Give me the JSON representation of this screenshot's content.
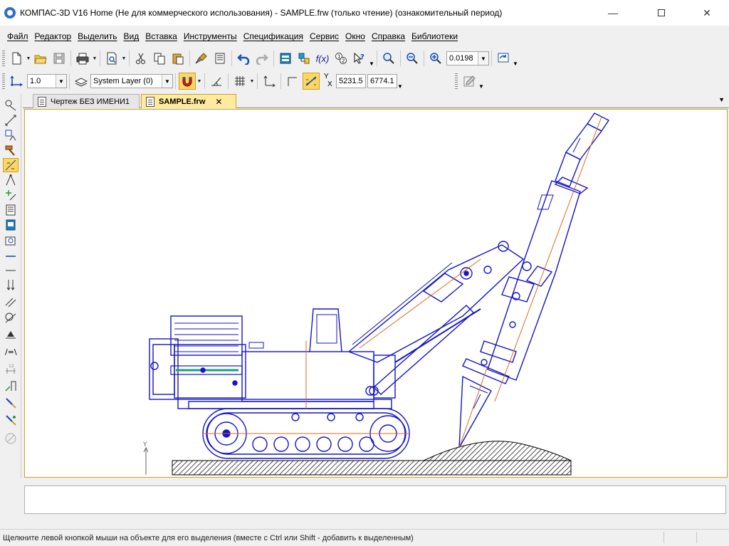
{
  "window": {
    "title": "КОМПАС-3D V16 Home  (Не для коммерческого использования) - SAMPLE.frw (только чтение) (ознакомительный период)",
    "minimize_icon": "minimize-icon",
    "maximize_icon": "maximize-icon",
    "close_icon": "close-icon"
  },
  "menu": {
    "items": [
      "Файл",
      "Редактор",
      "Выделить",
      "Вид",
      "Вставка",
      "Инструменты",
      "Спецификация",
      "Сервис",
      "Окно",
      "Справка",
      "Библиотеки"
    ]
  },
  "toolbar": {
    "zoom_value": "0.0198",
    "fx_label": "f(x)"
  },
  "properties_bar": {
    "line_scale": "1.0",
    "layer": "System Layer (0)",
    "y_label": "Y",
    "x_label": "X",
    "x_coord": "5231.5",
    "y_coord": "6774.1"
  },
  "tabs": [
    {
      "label": "Чертеж БЕЗ ИМЕНИ1",
      "active": false
    },
    {
      "label": "SAMPLE.frw",
      "active": true
    }
  ],
  "tab_close": "✕",
  "drawing": {
    "origin_y_label": "Y",
    "line_color": "#1414c8",
    "axis_color": "#e06a1a",
    "ground_color": "#000000"
  },
  "status": {
    "text": "Щелкните левой кнопкой мыши на объекте для его выделения (вместе с Ctrl или Shift - добавить к выделенным)"
  }
}
